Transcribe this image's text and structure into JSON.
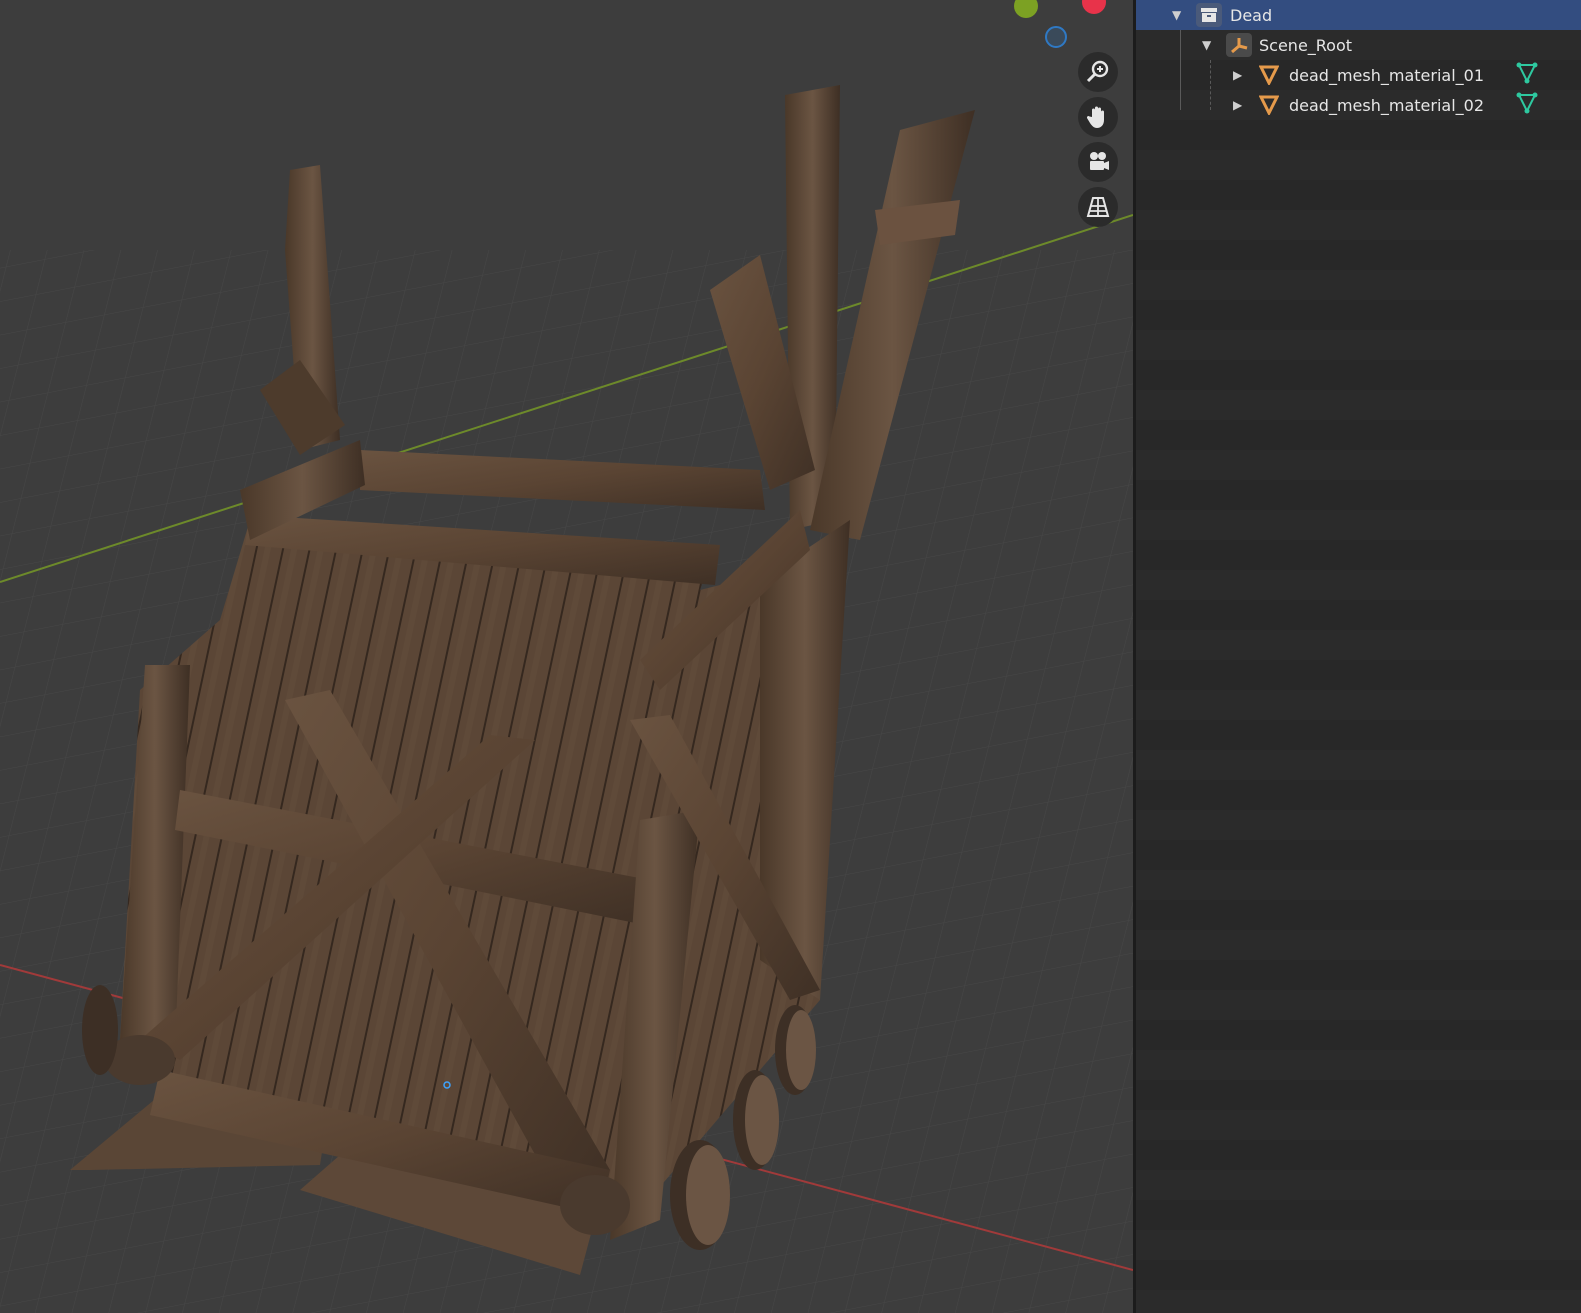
{
  "outliner": {
    "items": [
      {
        "label": "Dead",
        "icon": "collection-icon",
        "selected": true
      },
      {
        "label": "Scene_Root",
        "icon": "empty-object-icon",
        "selected": false
      },
      {
        "label": "dead_mesh_material_01",
        "icon": "mesh-object-icon",
        "data_icon": "mesh-data-icon",
        "selected": false
      },
      {
        "label": "dead_mesh_material_02",
        "icon": "mesh-object-icon",
        "data_icon": "mesh-data-icon",
        "selected": false
      }
    ]
  },
  "viewport": {
    "gizmo_buttons": [
      "zoom-icon",
      "hand-pan-icon",
      "camera-icon",
      "perspective-grid-icon"
    ],
    "axis_colors": {
      "x": "#e8334a",
      "y": "#7ca123",
      "z": "#2f79c4"
    },
    "selection_color": "#334d80"
  }
}
